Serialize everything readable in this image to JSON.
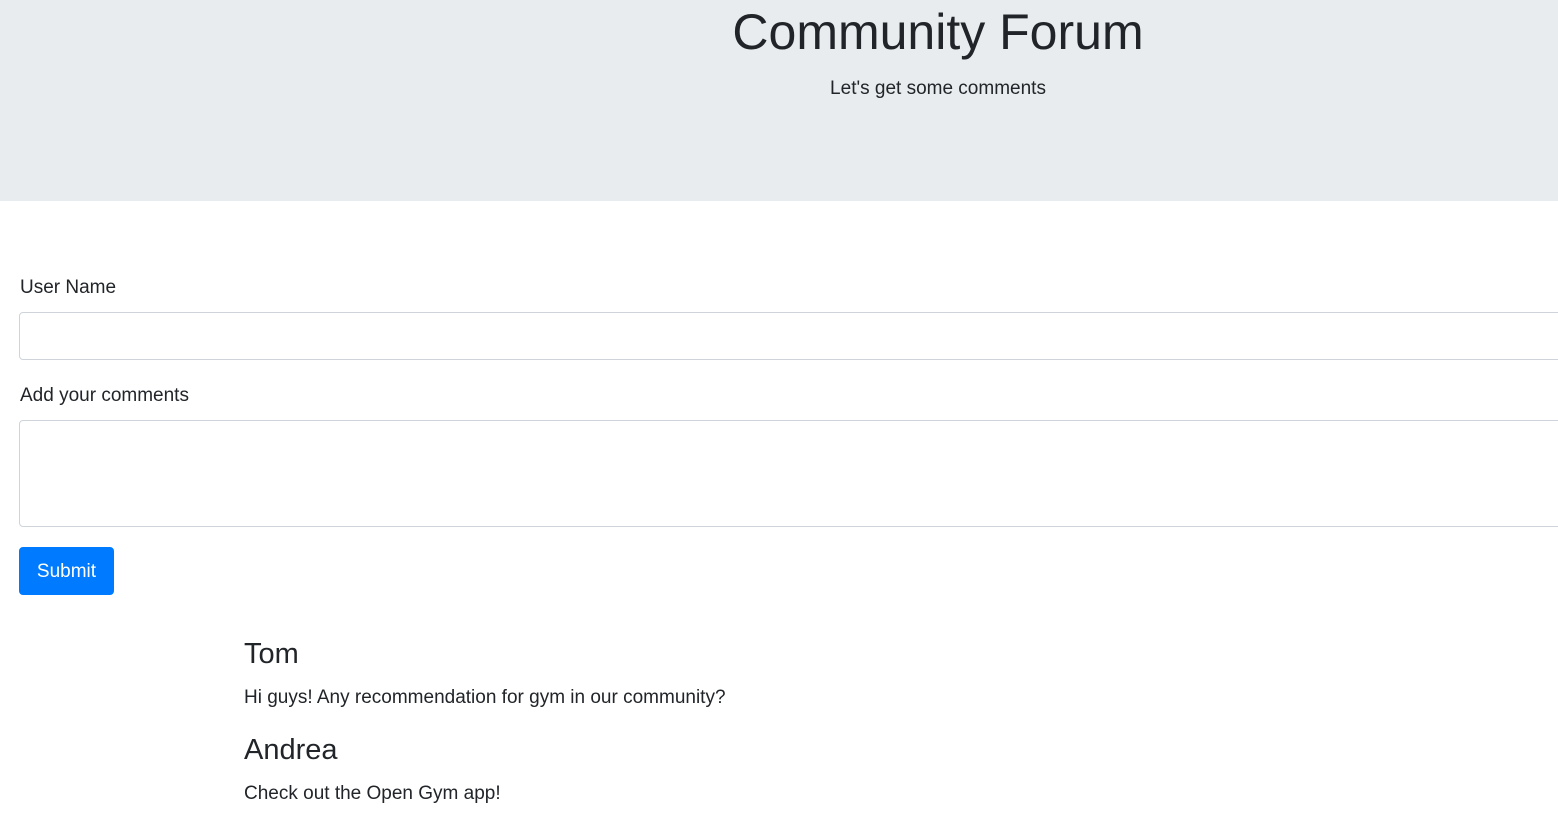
{
  "header": {
    "title": "Community Forum",
    "subtitle": "Let's get some comments"
  },
  "form": {
    "username_label": "User Name",
    "username_value": "",
    "comments_label": "Add your comments",
    "comments_value": "",
    "submit_label": "Submit"
  },
  "comments": [
    {
      "author": "Tom",
      "text": "Hi guys! Any recommendation for gym in our community?"
    },
    {
      "author": "Andrea",
      "text": "Check out the Open Gym app!"
    }
  ],
  "colors": {
    "header_background": "#e9ecef",
    "button_primary": "#007bff",
    "text": "#212529"
  }
}
